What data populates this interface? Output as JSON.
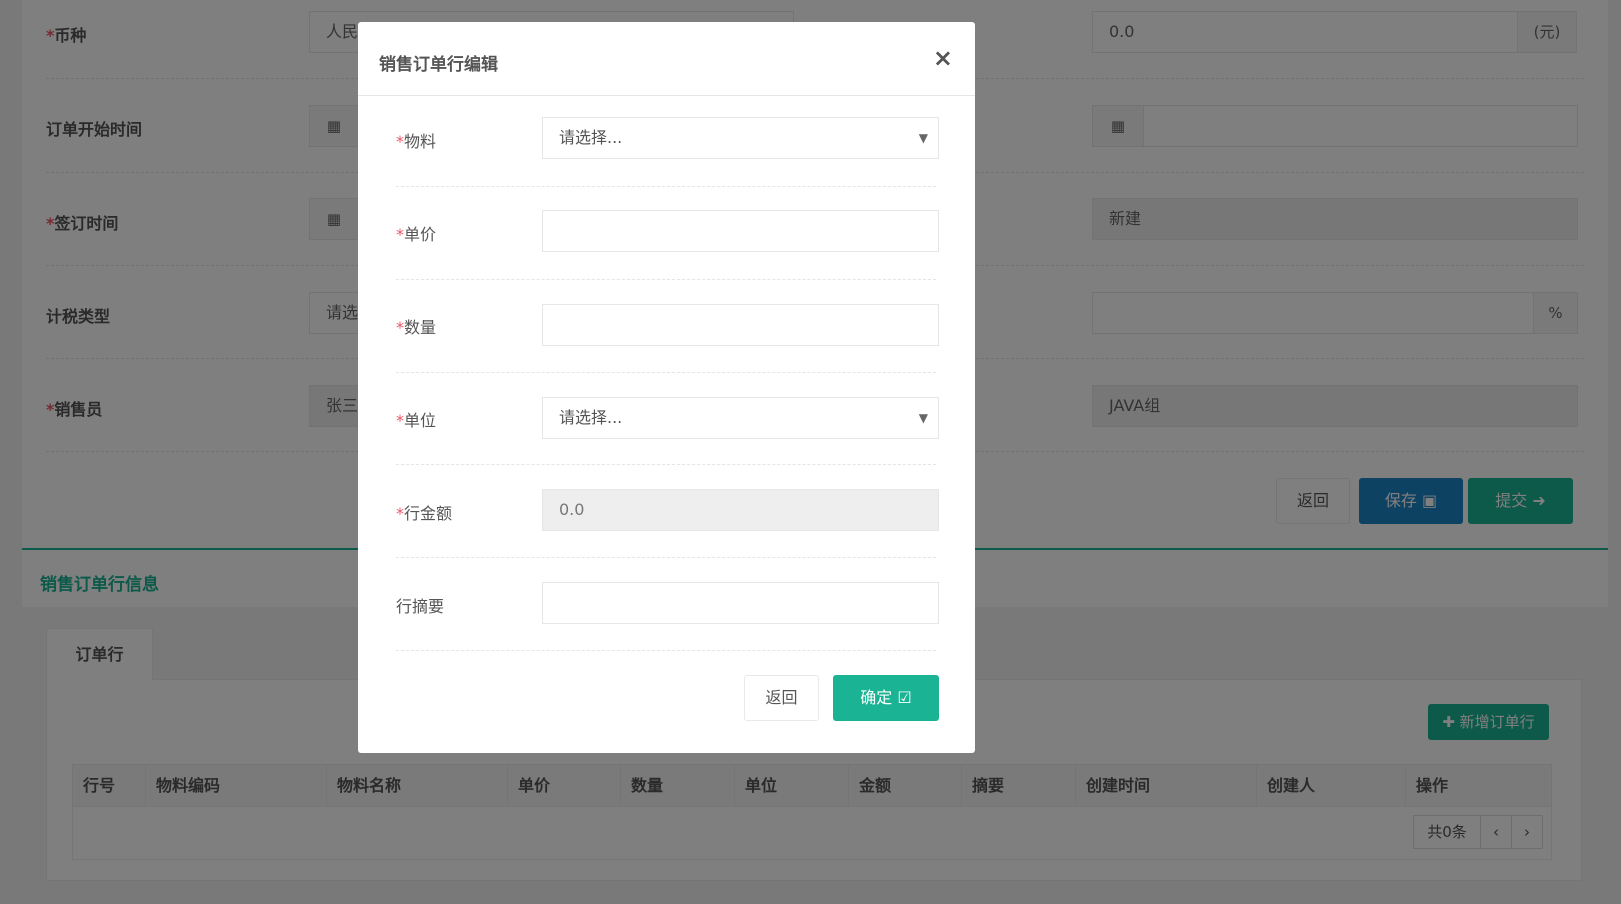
{
  "form": {
    "currency_label": "币种",
    "currency_value": "人民",
    "amount_value": "0.0",
    "amount_unit": "(元)",
    "order_start_label": "订单开始时间",
    "sign_time_label": "签订时间",
    "status_value": "新建",
    "tax_type_label": "计税类型",
    "tax_type_value": "请选",
    "rate_unit": "%",
    "salesperson_label": "销售员",
    "salesperson_value": "张三",
    "dept_value": "JAVA组",
    "back_label": "返回",
    "save_label": "保存",
    "submit_label": "提交"
  },
  "lines_section": {
    "title": "销售订单行信息",
    "tab_label": "订单行",
    "add_label": "新增订单行",
    "columns": [
      "行号",
      "物料编码",
      "物料名称",
      "单价",
      "数量",
      "单位",
      "金额",
      "摘要",
      "创建时间",
      "创建人",
      "操作"
    ],
    "total_text": "共0条",
    "prev": "‹",
    "next": "›"
  },
  "modal": {
    "title": "销售订单行编辑",
    "close": "×",
    "material_label": "物料",
    "material_placeholder": "请选择...",
    "price_label": "单价",
    "quantity_label": "数量",
    "unit_label": "单位",
    "unit_placeholder": "请选择...",
    "line_amount_label": "行金额",
    "line_amount_value": "0.0",
    "summary_label": "行摘要",
    "back_label": "返回",
    "confirm_label": "确定"
  },
  "colors": {
    "accent": "#1ab394",
    "primary": "#1c84c6",
    "required": "#ed5565"
  }
}
